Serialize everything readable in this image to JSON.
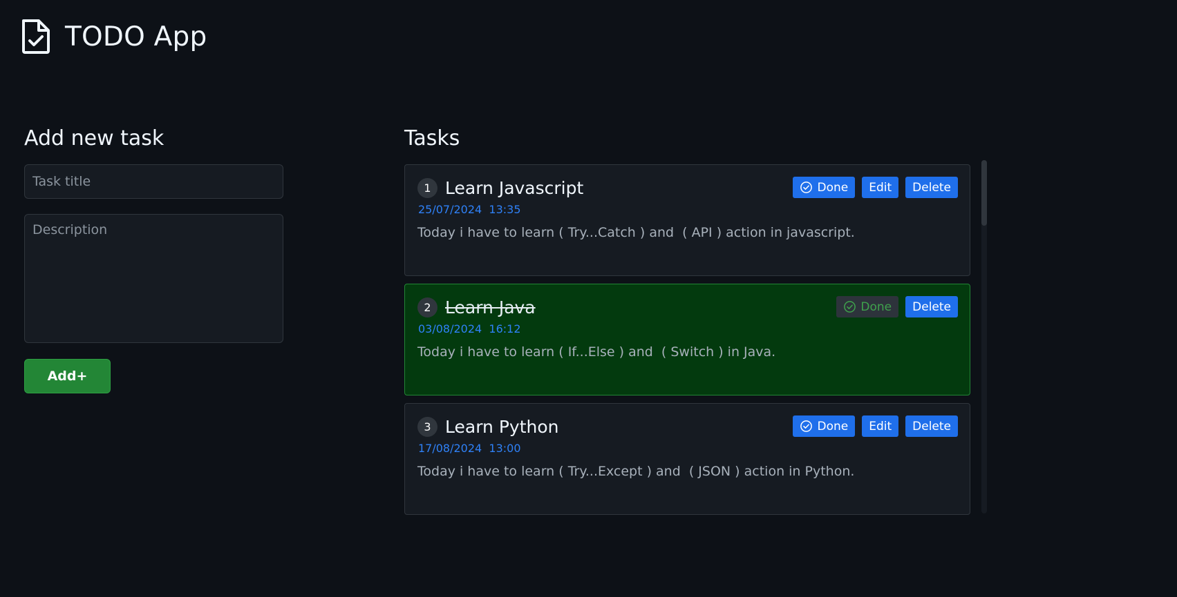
{
  "app": {
    "title": "TODO App",
    "logo_icon": "file-check-icon"
  },
  "add_task": {
    "heading": "Add new task",
    "title_placeholder": "Task title",
    "title_value": "",
    "description_placeholder": "Description",
    "description_value": "",
    "add_label": "Add+"
  },
  "tasks_section": {
    "heading": "Tasks"
  },
  "tasks": [
    {
      "number": "1",
      "title": "Learn Javascript",
      "date": "25/07/2024  13:35",
      "description": "Today i have to learn ( Try...Catch ) and  ( API ) action in javascript.",
      "done_label": "Done",
      "edit_label": "Edit",
      "delete_label": "Delete"
    },
    {
      "number": "2",
      "title": "Learn Java",
      "date": "03/08/2024  16:12",
      "description": "Today i have to learn ( If...Else ) and  ( Switch ) in Java.",
      "done_label": "Done",
      "delete_label": "Delete"
    },
    {
      "number": "3",
      "title": "Learn Python",
      "date": "17/08/2024  13:00",
      "description": "Today i have to learn ( Try...Except ) and  ( JSON ) action in Python.",
      "done_label": "Done",
      "edit_label": "Edit",
      "delete_label": "Delete"
    }
  ],
  "colors": {
    "background": "#0d1117",
    "card": "#161b22",
    "done_card": "#033a0e",
    "primary_button": "#1f6feb",
    "add_button": "#238636",
    "date_text": "#2f81f7"
  }
}
